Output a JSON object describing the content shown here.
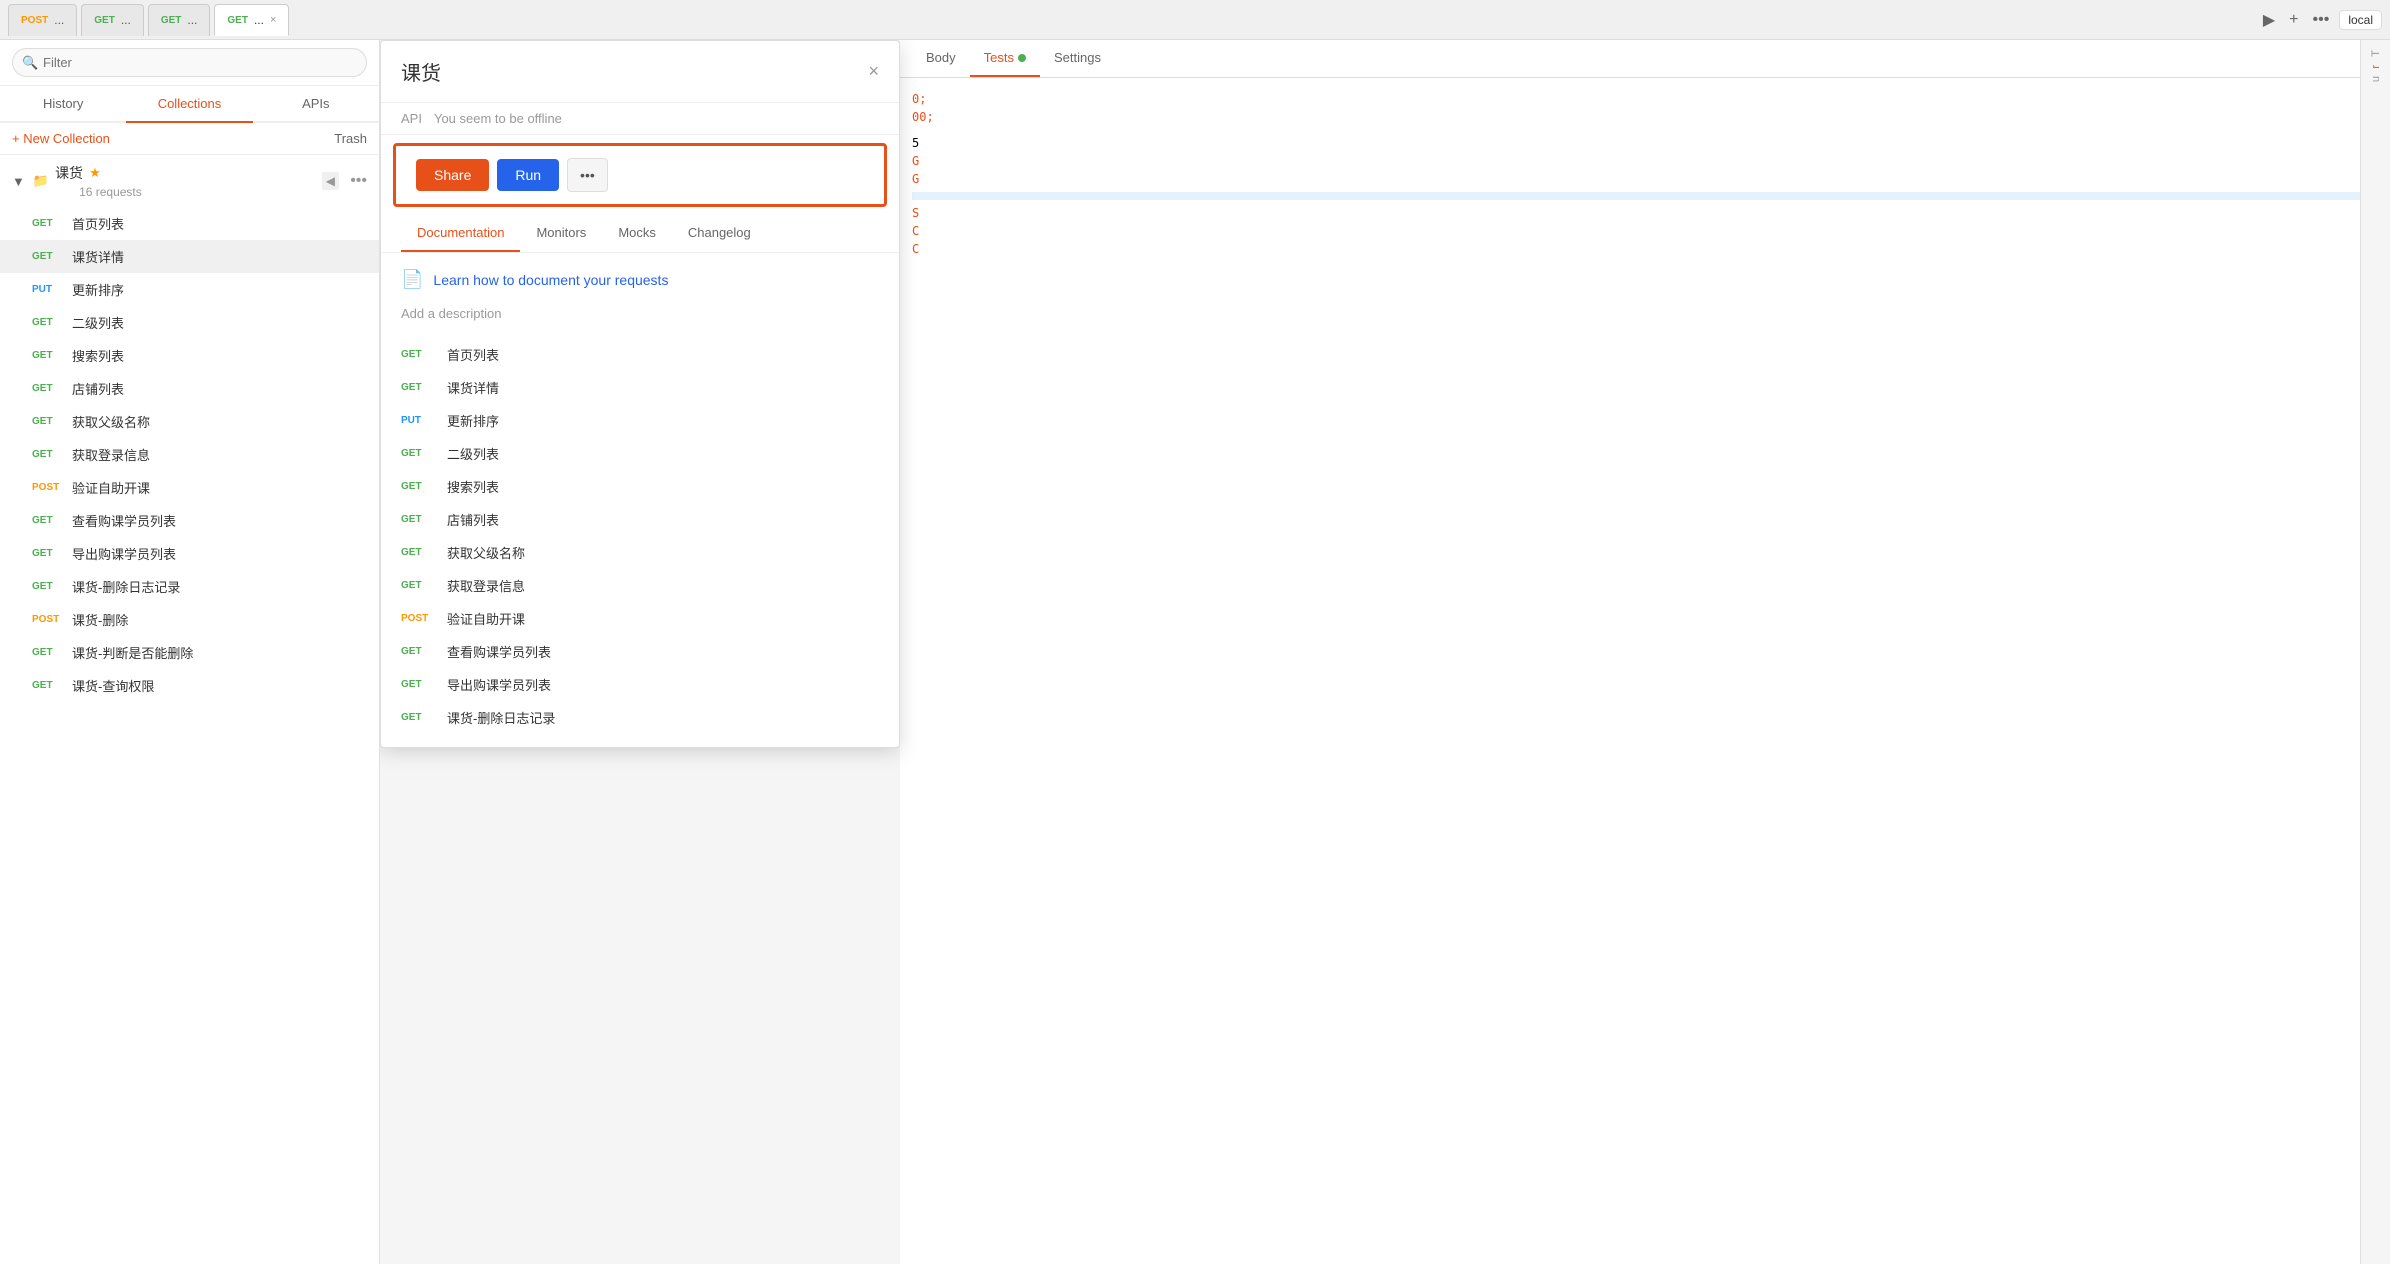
{
  "topTabs": [
    {
      "id": "post1",
      "method": "POST",
      "label": "...",
      "active": false
    },
    {
      "id": "get1",
      "method": "GET",
      "label": "...",
      "active": false
    },
    {
      "id": "get2",
      "method": "GET",
      "label": "...",
      "active": false
    },
    {
      "id": "get3",
      "method": "GET",
      "label": "...",
      "active": true,
      "hasClose": true
    }
  ],
  "localBadge": "local",
  "sidebar": {
    "searchPlaceholder": "Filter",
    "navItems": [
      {
        "id": "history",
        "label": "History"
      },
      {
        "id": "collections",
        "label": "Collections",
        "active": true
      },
      {
        "id": "apis",
        "label": "APIs"
      }
    ],
    "newCollectionLabel": "+ New Collection",
    "trashLabel": "Trash",
    "collection": {
      "name": "课货",
      "requestCount": "16 requests",
      "starred": true
    },
    "requests": [
      {
        "method": "GET",
        "name": "首页列表"
      },
      {
        "method": "GET",
        "name": "课货详情",
        "active": true
      },
      {
        "method": "PUT",
        "name": "更新排序"
      },
      {
        "method": "GET",
        "name": "二级列表"
      },
      {
        "method": "GET",
        "name": "搜索列表"
      },
      {
        "method": "GET",
        "name": "店铺列表"
      },
      {
        "method": "GET",
        "name": "获取父级名称"
      },
      {
        "method": "GET",
        "name": "获取登录信息"
      },
      {
        "method": "POST",
        "name": "验证自助开课"
      },
      {
        "method": "GET",
        "name": "查看购课学员列表"
      },
      {
        "method": "GET",
        "name": "导出购课学员列表"
      },
      {
        "method": "GET",
        "name": "课货-删除日志记录"
      },
      {
        "method": "POST",
        "name": "课货-删除"
      },
      {
        "method": "GET",
        "name": "课货-判断是否能删除"
      },
      {
        "method": "GET",
        "name": "课货-查询权限"
      }
    ]
  },
  "modal": {
    "title": "课货",
    "closeLabel": "×",
    "apiLabel": "API",
    "offlineNotice": "You seem to be offline",
    "shareLabel": "Share",
    "runLabel": "Run",
    "moreLabel": "•••",
    "tabs": [
      {
        "id": "documentation",
        "label": "Documentation",
        "active": true
      },
      {
        "id": "monitors",
        "label": "Monitors"
      },
      {
        "id": "mocks",
        "label": "Mocks"
      },
      {
        "id": "changelog",
        "label": "Changelog"
      }
    ],
    "learnLink": "Learn how to document your requests",
    "addDescription": "Add a description",
    "endpoints": [
      {
        "method": "GET",
        "name": "首页列表"
      },
      {
        "method": "GET",
        "name": "课货详情"
      },
      {
        "method": "PUT",
        "name": "更新排序"
      },
      {
        "method": "GET",
        "name": "二级列表"
      },
      {
        "method": "GET",
        "name": "搜索列表"
      },
      {
        "method": "GET",
        "name": "店铺列表"
      },
      {
        "method": "GET",
        "name": "获取父级名称"
      },
      {
        "method": "GET",
        "name": "获取登录信息"
      },
      {
        "method": "POST",
        "name": "验证自助开课"
      },
      {
        "method": "GET",
        "name": "查看购课学员列表"
      },
      {
        "method": "GET",
        "name": "导出购课学员列表"
      },
      {
        "method": "GET",
        "name": "课货-删除日志记录"
      }
    ]
  },
  "subTabs": [
    {
      "id": "body",
      "label": "Body",
      "active": false
    },
    {
      "id": "tests",
      "label": "Tests",
      "active": true,
      "hasDot": true
    },
    {
      "id": "settings",
      "label": "Settings",
      "active": false
    }
  ],
  "codeLines": [
    {
      "text": "0;",
      "color": "orange"
    },
    {
      "text": "00;",
      "color": "orange"
    },
    {
      "text": "5",
      "color": "default"
    },
    {
      "text": "G",
      "color": "orange"
    },
    {
      "text": "G",
      "color": "orange"
    },
    {
      "text": "S",
      "color": "orange"
    },
    {
      "text": "C",
      "color": "orange"
    },
    {
      "text": "C",
      "color": "orange"
    }
  ],
  "rightLabels": [
    "T",
    "r",
    "u"
  ]
}
